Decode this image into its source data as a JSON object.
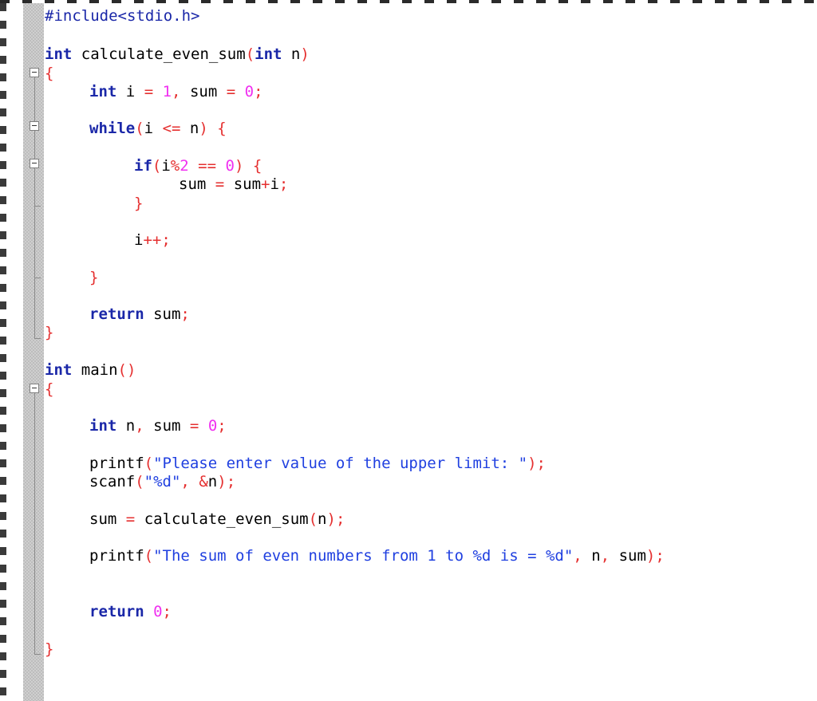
{
  "editor": {
    "language": "C",
    "lines": [
      {
        "text": "#include<stdio.h>"
      },
      {
        "text": "int calculate_even_sum(int n)"
      },
      {
        "text": "{"
      },
      {
        "text": "int i = 1, sum = 0;"
      },
      {
        "text": "while(i <= n) {"
      },
      {
        "text": "if(i%2 == 0) {"
      },
      {
        "text": "sum = sum+i;"
      },
      {
        "text": "}"
      },
      {
        "text": "i++;"
      },
      {
        "text": "}"
      },
      {
        "text": "return sum;"
      },
      {
        "text": "}"
      },
      {
        "text": "int main()"
      },
      {
        "text": "{"
      },
      {
        "text": "int n, sum = 0;"
      },
      {
        "text": "printf(\"Please enter value of the upper limit: \");"
      },
      {
        "text": "scanf(\"%d\", &n);"
      },
      {
        "text": "sum = calculate_even_sum(n);"
      },
      {
        "text": "printf(\"The sum of even numbers from 1 to %d is = %d\", n, sum);"
      },
      {
        "text": "return 0;"
      },
      {
        "text": "}"
      }
    ],
    "tokens": {
      "include": "#include<stdio.h>",
      "int": "int",
      "fn_name": "calculate_even_sum",
      "lparen": "(",
      "rparen": ")",
      "n": "n",
      "lbrace": "{",
      "rbrace": "}",
      "i": "i",
      "eq": "=",
      "one": "1",
      "comma": ",",
      "sum": "sum",
      "zero": "0",
      "semi": ";",
      "while": "while",
      "le": "<=",
      "if": "if",
      "mod": "%",
      "two": "2",
      "eqeq": "==",
      "plus": "+",
      "incr": "++",
      "return": "return",
      "main": "main",
      "printf": "printf",
      "scanf": "scanf",
      "amp": "&",
      "str_prompt": "\"Please enter value of the upper limit: \"",
      "str_fmt": "\"%d\"",
      "str_result": "\"The sum of even numbers from 1 to %d is = %d\""
    },
    "colors": {
      "keyword": "#1a27a8",
      "operator": "#e53030",
      "number": "#f030f0",
      "string": "#2040e0",
      "identifier": "#000000"
    }
  }
}
